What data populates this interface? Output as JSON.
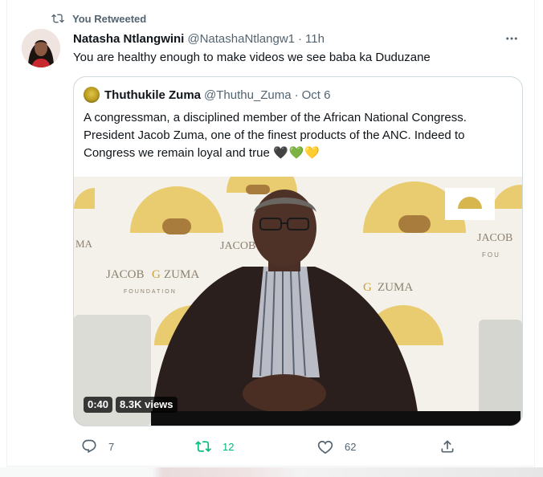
{
  "retweet_context": {
    "label": "You Retweeted"
  },
  "tweet": {
    "author_name": "Natasha Ntlangwini",
    "author_handle": "@NatashaNtlangw1",
    "separator": "·",
    "time": "11h",
    "text": "You are healthy enough to make videos we see baba ka Duduzane"
  },
  "quote": {
    "author_name": "Thuthukile Zuma",
    "author_handle": "@Thuthu_Zuma",
    "separator": "·",
    "time": "Oct 6",
    "text": "A congressman, a disciplined member of the African National Congress. President Jacob Zuma, one of the finest products of the ANC. Indeed to Congress we remain loyal and true",
    "hearts": "🖤💚💛"
  },
  "video": {
    "duration": "0:40",
    "views": "8.3K views",
    "backdrop_text": {
      "jacob": "JACOB",
      "g": "G",
      "zuma": "ZUMA",
      "foundation": "FOUNDATION",
      "ma": "MA",
      "jacob_right": "JACOB",
      "fou": "FOU"
    }
  },
  "actions": {
    "replies": "7",
    "retweets": "12",
    "likes": "62"
  },
  "colors": {
    "retweet_active": "#00ba7c",
    "muted": "#536471",
    "border": "#cfd9de"
  }
}
